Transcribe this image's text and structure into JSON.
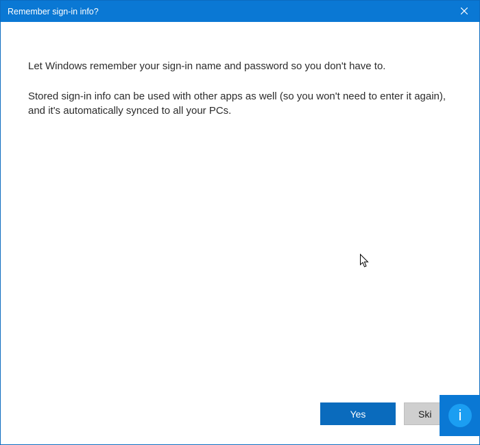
{
  "titlebar": {
    "title": "Remember sign-in info?"
  },
  "content": {
    "paragraph1": "Let Windows remember your sign-in name and password so you don't have to.",
    "paragraph2": "Stored sign-in info can be used with other apps as well (so you won't need to enter it again), and it's automatically synced to all your PCs."
  },
  "footer": {
    "yes_label": "Yes",
    "skip_label": "Ski"
  },
  "badge": {
    "letter": "i"
  }
}
